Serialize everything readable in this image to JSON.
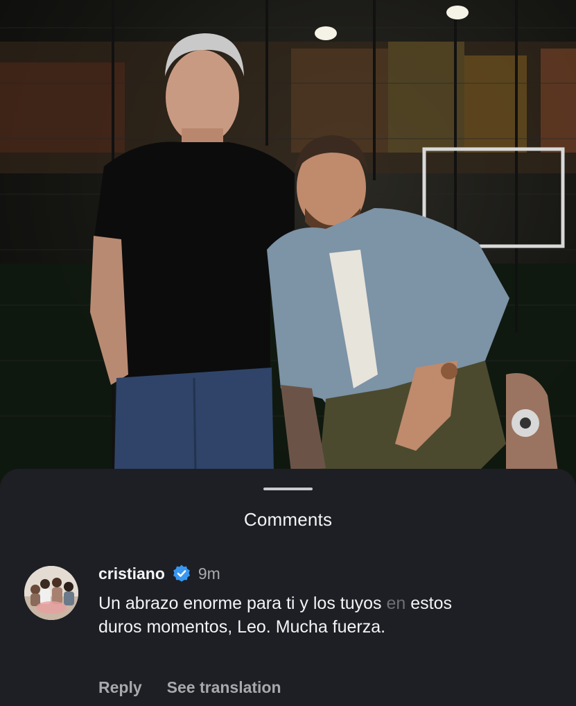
{
  "sheet": {
    "title": "Comments"
  },
  "comment": {
    "username": "cristiano",
    "verified_icon": "verified-badge-icon",
    "time": "9m",
    "text_main": "Un abrazo enorme para ti y los tuyos ",
    "text_faded": "en",
    "text_rest": " estos duros momentos, Leo. Mucha fuerza.",
    "reply_label": "Reply",
    "translation_label": "See translation"
  },
  "colors": {
    "sheet_bg": "#1e1f24",
    "primary_text": "#f3f4f6",
    "secondary_text": "#a8a9ad",
    "verified_blue": "#3897f0"
  }
}
